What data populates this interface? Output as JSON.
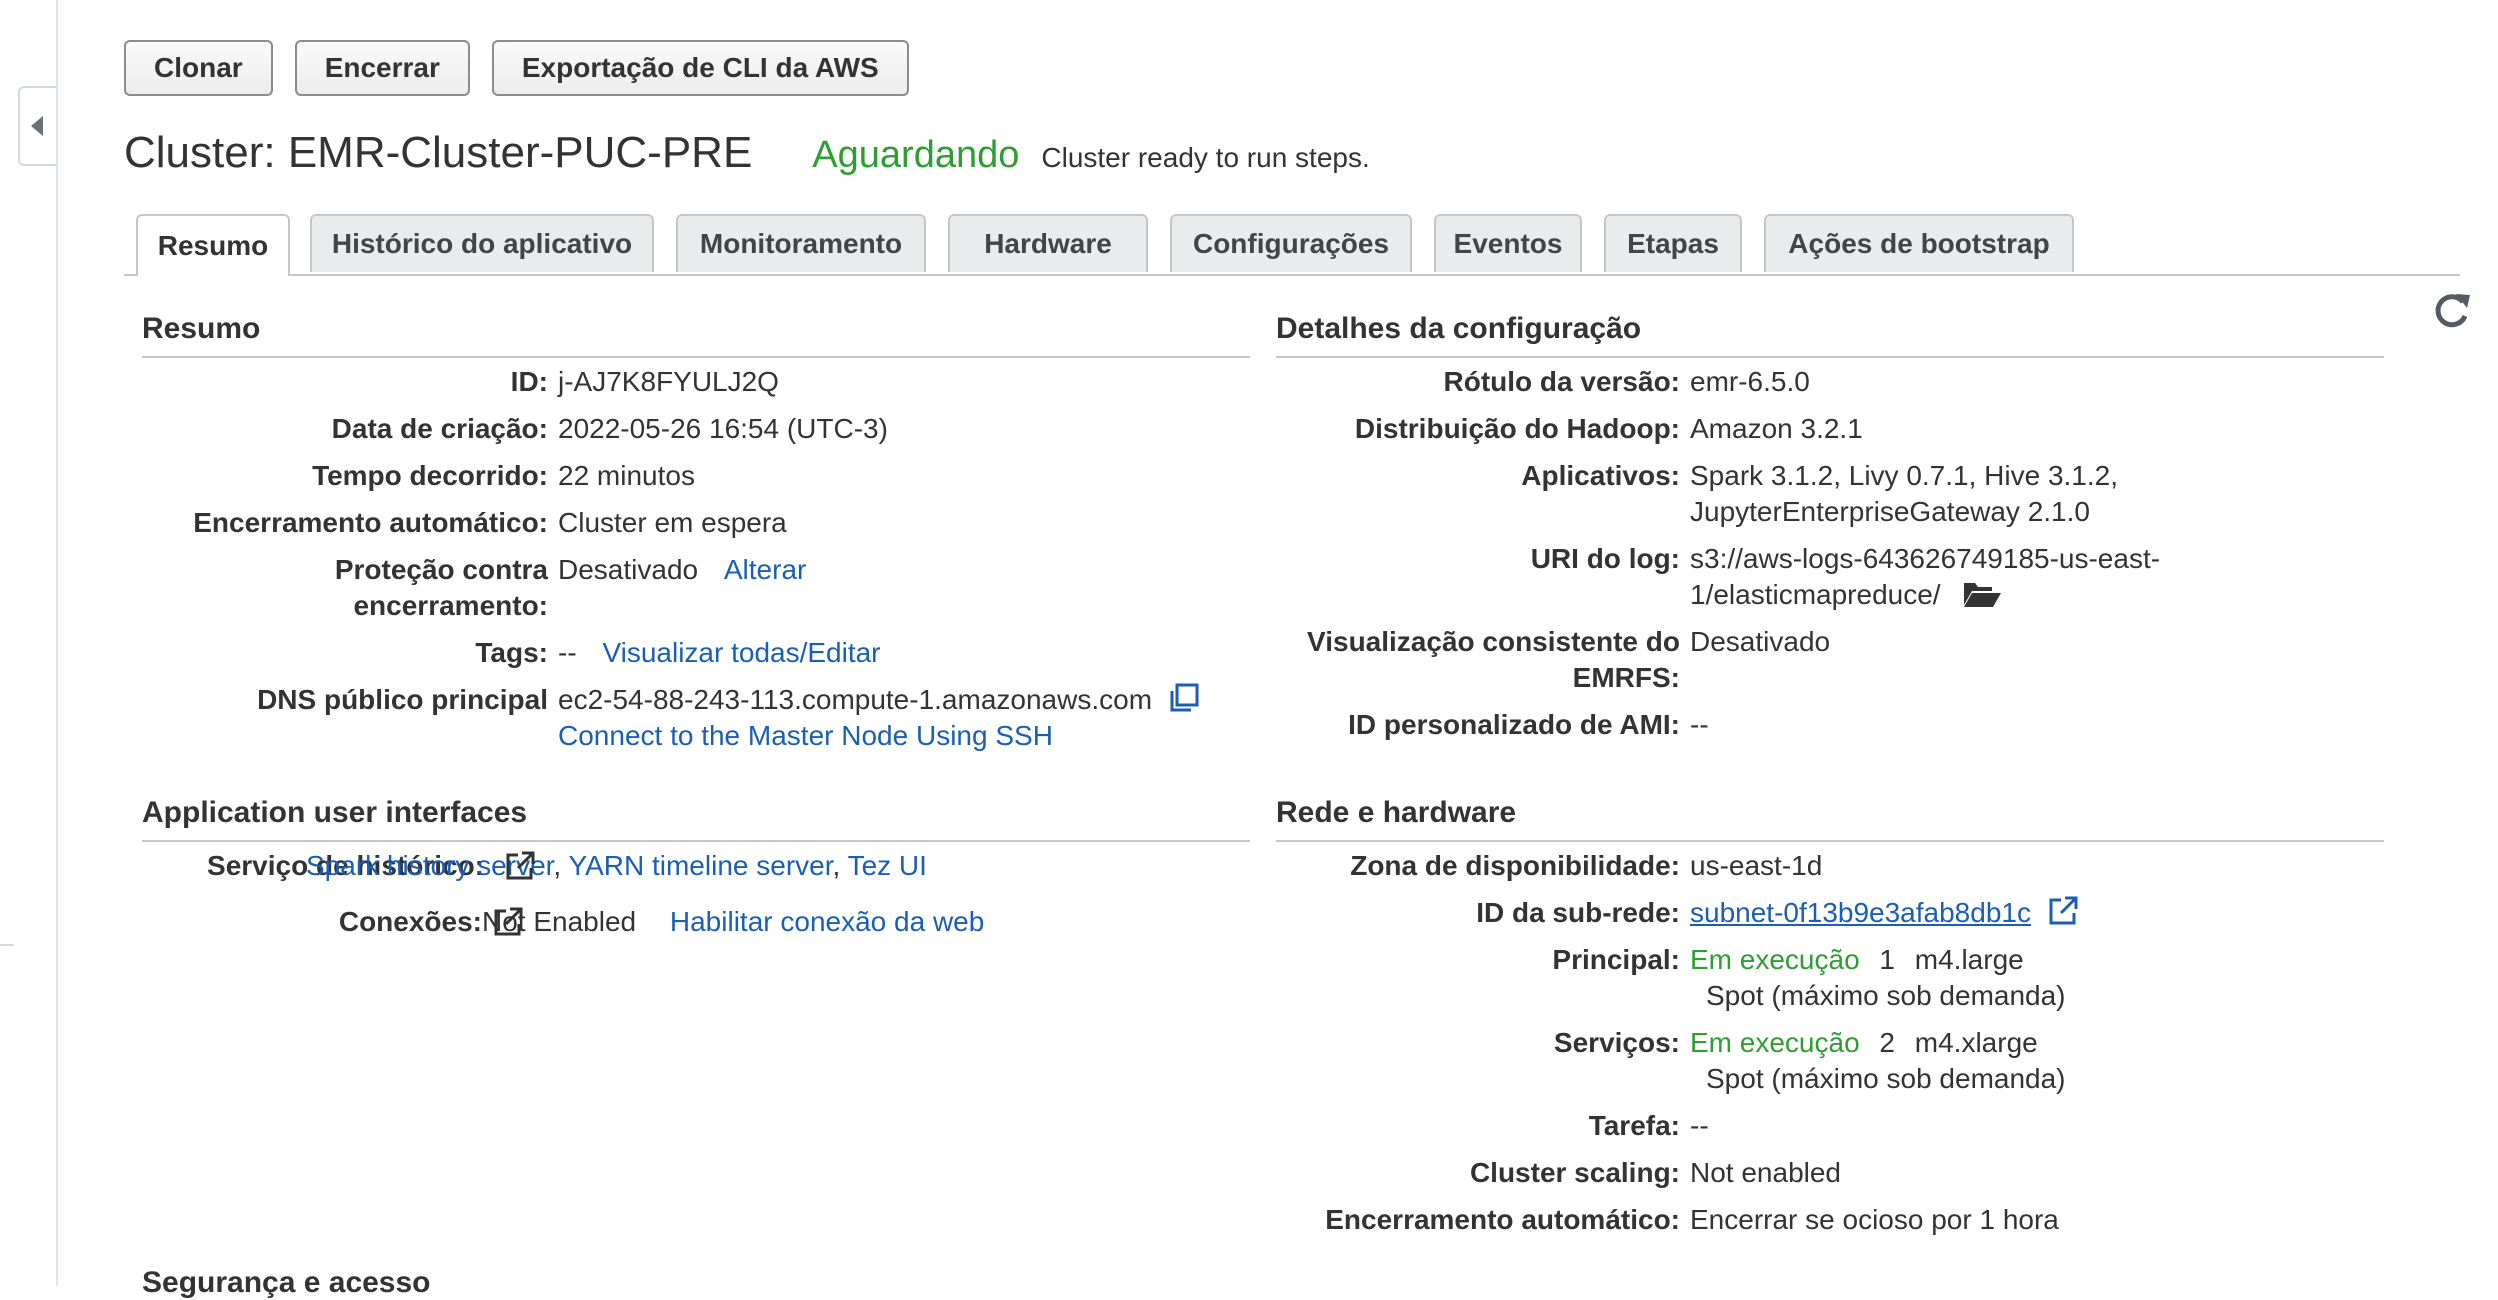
{
  "toolbar": {
    "clone": "Clonar",
    "terminate": "Encerrar",
    "cli_export": "Exportação de CLI da AWS"
  },
  "header": {
    "title": "Cluster: EMR-Cluster-PUC-PRE",
    "status": "Aguardando",
    "status_desc": "Cluster ready to run steps."
  },
  "tabs": [
    "Resumo",
    "Histórico do aplicativo",
    "Monitoramento",
    "Hardware",
    "Configurações",
    "Eventos",
    "Etapas",
    "Ações de bootstrap"
  ],
  "summary": {
    "heading": "Resumo",
    "id_label": "ID:",
    "id_value": "j-AJ7K8FYULJ2Q",
    "created_label": "Data de criação:",
    "created_value": "2022-05-26 16:54 (UTC-3)",
    "elapsed_label": "Tempo decorrido:",
    "elapsed_value": "22 minutos",
    "autoterm_label": "Encerramento automático:",
    "autoterm_value": "Cluster em espera",
    "protection_label_1": "Proteção contra",
    "protection_label_2": "encerramento:",
    "protection_value": "Desativado",
    "protection_link": "Alterar",
    "tags_label": "Tags:",
    "tags_value": "--",
    "tags_link": "Visualizar todas/Editar",
    "dns_label": "DNS público principal",
    "dns_value": "ec2-54-88-243-113.compute-1.amazonaws.com",
    "ssh_link": "Connect to the Master Node Using SSH"
  },
  "app_ui": {
    "heading": "Application user interfaces",
    "history_label": "Serviço de histórico:",
    "spark_link": "Spark history server",
    "yarn_link": "YARN timeline server",
    "tez_link": "Tez UI",
    "sep": ",",
    "conn_label": "Conexões:",
    "conn_value": "Not Enabled",
    "conn_link": "Habilitar conexão da web"
  },
  "config": {
    "heading": "Detalhes da configuração",
    "release_label": "Rótulo da versão:",
    "release_value": "emr-6.5.0",
    "hadoop_label": "Distribuição do Hadoop:",
    "hadoop_value": "Amazon 3.2.1",
    "apps_label": "Aplicativos:",
    "apps_value_1": "Spark 3.1.2, Livy 0.7.1, Hive 3.1.2,",
    "apps_value_2": "JupyterEnterpriseGateway 2.1.0",
    "log_label": "URI do log:",
    "log_value_1": "s3://aws-logs-643626749185-us-east-",
    "log_value_2": "1/elasticmapreduce/",
    "emrfs_label_1": "Visualização consistente do",
    "emrfs_label_2": "EMRFS:",
    "emrfs_value": "Desativado",
    "ami_label": "ID personalizado de AMI:",
    "ami_value": "--"
  },
  "network": {
    "heading": "Rede e hardware",
    "az_label": "Zona de disponibilidade:",
    "az_value": "us-east-1d",
    "subnet_label": "ID da sub-rede:",
    "subnet_value": "subnet-0f13b9e3afab8db1c",
    "master_label": "Principal:",
    "master_status": "Em execução",
    "master_count": "1",
    "master_type": "m4.large",
    "master_market": "Spot (máximo sob demanda)",
    "core_label": "Serviços:",
    "core_status": "Em execução",
    "core_count": "2",
    "core_type": "m4.xlarge",
    "core_market": "Spot (máximo sob demanda)",
    "task_label": "Tarefa:",
    "task_value": "--",
    "scaling_label": "Cluster scaling:",
    "scaling_value": "Not enabled",
    "autoterm_label": "Encerramento automático:",
    "autoterm_value": "Encerrar se ocioso por 1 hora"
  },
  "security": {
    "heading": "Segurança e acesso"
  },
  "colors": {
    "status_green": "#2e9e32",
    "link_blue": "#1a5fb4",
    "text": "#333333",
    "divider": "#c7c7c7"
  }
}
